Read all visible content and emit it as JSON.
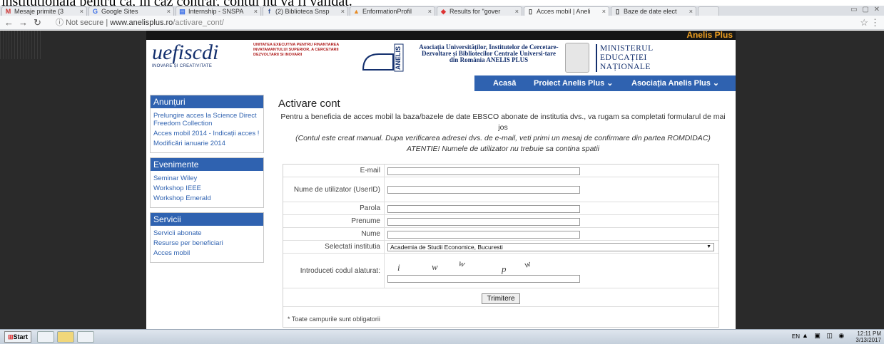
{
  "document": {
    "top_text": "instituționala pentru ca, în caz contrar, contul nu va fi validat."
  },
  "browser": {
    "tabs": [
      {
        "icon": "gmail-icon",
        "label": "Mesaje primite (3"
      },
      {
        "icon": "google-icon",
        "label": "Google Sites"
      },
      {
        "icon": "sites-icon",
        "label": "Internship - SNSPA"
      },
      {
        "icon": "facebook-icon",
        "label": "(2) Biblioteca Snsp"
      },
      {
        "icon": "page-icon",
        "label": "EnformationProfil"
      },
      {
        "icon": "results-icon",
        "label": "Results for \"gover"
      },
      {
        "icon": "page-icon",
        "label": "Acces mobil | Aneli"
      },
      {
        "icon": "page-icon",
        "label": "Baze de date elect"
      }
    ],
    "address": {
      "security": "Not secure",
      "host": "www.anelisplus.ro",
      "path": "/activare_cont/"
    }
  },
  "site": {
    "brand": "Anelis Plus",
    "uefiscdi": {
      "logo_text": "uefiscdi",
      "tagline": "INOVARE ȘI CREATIVITATE",
      "sub": "UNITATEA EXECUTIVA PENTRU FINANTAREA INVATAMANTULUI SUPERIOR, A CERCETARII DEZVOLTARII SI INOVARII"
    },
    "anelis_logo": "ANELIS",
    "anelis_title": "Asociația Universităților, Institutelor de Cercetare-Dezvoltare și Bibliotecilor Centrale Universi-tare din România ANELIS PLUS",
    "ministry": [
      "MINISTERUL",
      "EDUCAȚIEI",
      "NAȚIONALE"
    ],
    "nav": {
      "home": "Acasă",
      "project": "Proiect Anelis Plus ⌄",
      "assoc": "Asociația Anelis Plus ⌄"
    },
    "sidebar": {
      "announcements": {
        "title": "Anunțuri",
        "items": [
          "Prelungire acces la Science Direct Freedom Collection",
          "Acces mobil 2014 - Indicații acces !",
          "Modificări ianuarie 2014"
        ]
      },
      "events": {
        "title": "Evenimente",
        "items": [
          "Seminar Wiley",
          "Workshop IEEE",
          "Workshop Emerald"
        ]
      },
      "services": {
        "title": "Servicii",
        "items": [
          "Servicii abonate",
          "Resurse per beneficiari",
          "Acces mobil"
        ]
      }
    },
    "page": {
      "title": "Activare cont",
      "intro1": "Pentru a beneficia de acces mobil la baza/bazele de date EBSCO abonate de institutia dvs., va rugam sa completati formularul de mai jos",
      "intro2": "(Contul este creat manual. Dupa verificarea adresei dvs. de e-mail, veti primi un mesaj de confirmare din partea ROMDIDAC)",
      "intro3": "ATENTIE! Numele de utilizator nu trebuie sa contina spatii",
      "form": {
        "email": "E-mail",
        "username": "Nume de utilizator (UserID)",
        "password": "Parola",
        "firstname": "Prenume",
        "lastname": "Nume",
        "institution": "Selectati institutia",
        "institution_value": "Academia de Studii Economice, Bucuresti",
        "captcha_label": "Introduceti codul alaturat:",
        "captcha_chars": [
          "i",
          "w",
          "w",
          "p",
          "w"
        ],
        "submit": "Trimitere",
        "note": "* Toate campurile sunt obligatorii"
      }
    }
  },
  "taskbar": {
    "start": "Start",
    "lang": "EN",
    "time": "12:11 PM",
    "date": "3/13/2017"
  }
}
